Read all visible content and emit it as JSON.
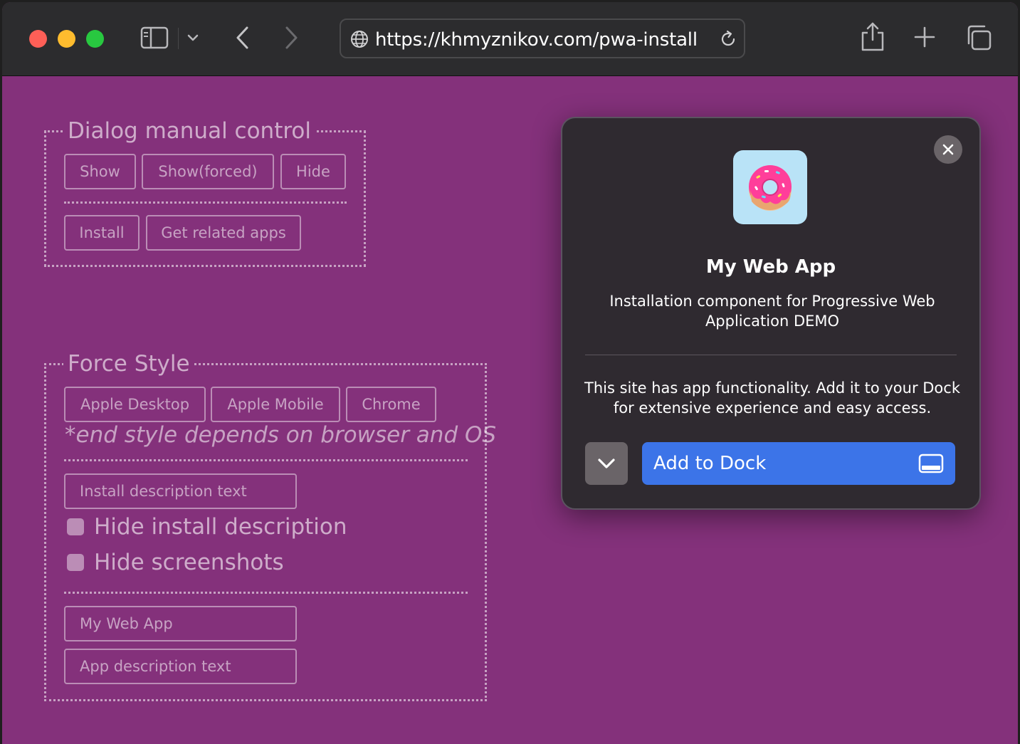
{
  "browser": {
    "url": "https://khmyznikov.com/pwa-install",
    "colors": {
      "toolbar": "#2c2c2e",
      "page_background": "#84317b"
    },
    "icons": [
      "sidebar-icon",
      "chevron-down-icon",
      "back-icon",
      "forward-icon",
      "globe-icon",
      "reload-icon",
      "share-icon",
      "plus-icon",
      "tabs-icon"
    ]
  },
  "dialog_control": {
    "legend": "Dialog manual control",
    "buttons": {
      "show": "Show",
      "show_forced": "Show(forced)",
      "hide": "Hide",
      "install": "Install",
      "related_apps": "Get related apps"
    }
  },
  "force_style": {
    "legend": "Force Style",
    "buttons": {
      "apple_desktop": "Apple Desktop",
      "apple_mobile": "Apple Mobile",
      "chrome": "Chrome"
    },
    "note": "*end style depends on browser and OS",
    "install_description_field": "Install description text",
    "checkboxes": {
      "hide_install_description": "Hide install description",
      "hide_screenshots": "Hide screenshots"
    },
    "app_name_field": "My Web App",
    "app_description_field": "App description text"
  },
  "install_dialog": {
    "app_name": "My Web App",
    "app_description": "Installation component for Progressive Web Application DEMO",
    "install_description": "This site has app functionality. Add it to your Dock for extensive experience and easy access.",
    "primary_action": "Add to Dock",
    "colors": {
      "background": "#2f2a30",
      "primary": "#3c74e8",
      "icon_background": "#b9e3f7"
    }
  }
}
